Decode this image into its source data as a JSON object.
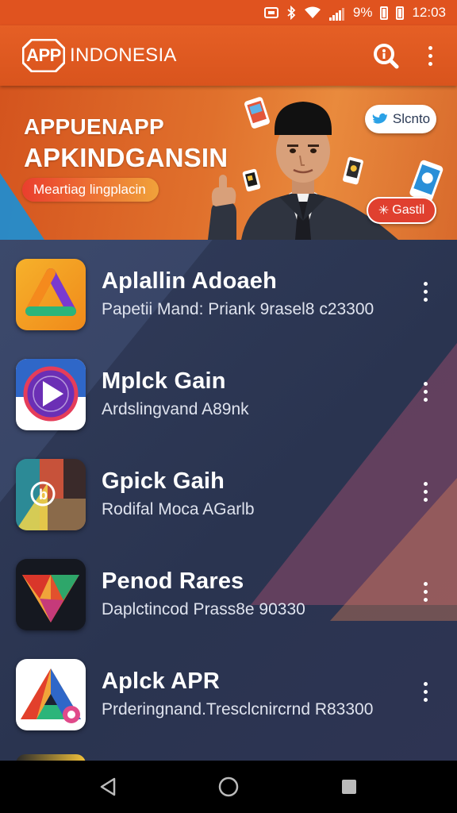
{
  "status_bar": {
    "battery_percent": "9%",
    "time": "12:03",
    "icons": [
      "notification-icon",
      "bluetooth-icon",
      "wifi-icon",
      "signal-icon",
      "battery-icon"
    ]
  },
  "app_bar": {
    "logo_badge": "APP",
    "logo_text": "INDONESIA",
    "search_icon": "search-icon",
    "menu_icon": "more-vert-icon"
  },
  "banner": {
    "title_line1": "APPUENAPP",
    "title_line2": "APKINDGANSIN",
    "pill_label": "Meartiag lingplacin",
    "chip_label": "Slcnto",
    "button_label": "Gastil",
    "colors": {
      "primary": "#e0531f",
      "accent_blue": "#1a8fd6",
      "button": "#e0402f"
    }
  },
  "apps": [
    {
      "name": "Aplallin Adoaeh",
      "subtitle": "Papetii Mand: Priank 9rasel8 c23300",
      "icon": "orange-triangle-app-icon"
    },
    {
      "name": "Mplck Gain",
      "subtitle": "Ardslingvand A89nk",
      "icon": "play-circle-app-icon"
    },
    {
      "name": "Gpick Gaih",
      "subtitle": "Rodifal Moca AGarlb",
      "icon": "photo-collage-app-icon"
    },
    {
      "name": "Penod Rares",
      "subtitle": "Daplctincod Prass8e 90330",
      "icon": "prism-triangle-app-icon"
    },
    {
      "name": "Aplck APR",
      "subtitle": "Prderingnand.Tresclcnircrnd R83300",
      "icon": "colorful-triangle-app-icon"
    }
  ],
  "nav_bar": {
    "back_icon": "back-icon",
    "home_icon": "home-icon",
    "recents_icon": "recents-icon"
  }
}
